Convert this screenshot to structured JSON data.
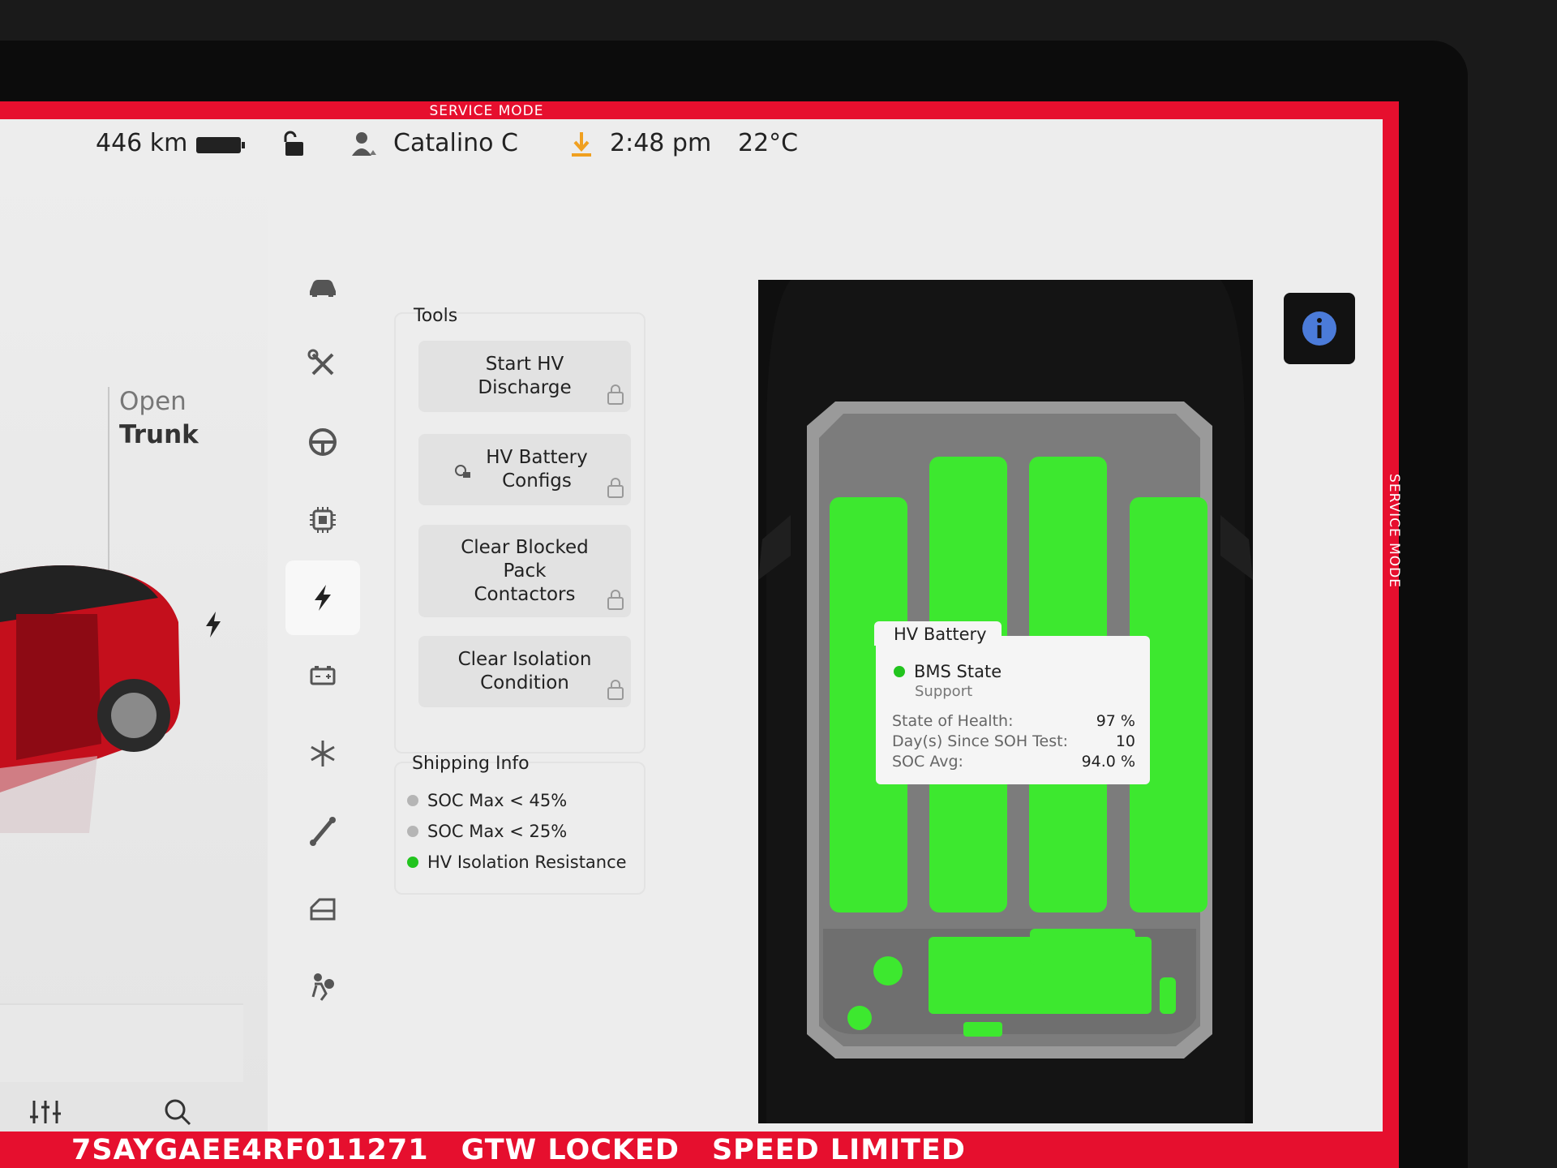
{
  "banner": {
    "top": "SERVICE MODE",
    "right": "SERVICE MODE"
  },
  "status": {
    "range": "446 km",
    "user": "Catalino C",
    "time": "2:48 pm",
    "temp": "22°C"
  },
  "car": {
    "trunk_open": "Open",
    "trunk_label": "Trunk"
  },
  "tools": {
    "title": "Tools",
    "items": [
      {
        "label": "Start HV Discharge"
      },
      {
        "label": "HV Battery Configs"
      },
      {
        "label": "Clear Blocked Pack Contactors"
      },
      {
        "label": "Clear Isolation Condition"
      }
    ]
  },
  "shipping": {
    "title": "Shipping Info",
    "items": [
      {
        "label": "SOC Max < 45%",
        "color": "#b5b5b5"
      },
      {
        "label": "SOC Max < 25%",
        "color": "#b5b5b5"
      },
      {
        "label": "HV Isolation Resistance",
        "color": "#22c41e"
      }
    ]
  },
  "battery_card": {
    "title": "HV Battery",
    "bms_label": "BMS State",
    "bms_value": "Support",
    "soh_label": "State of Health:",
    "soh_value": "97 %",
    "days_label": "Day(s) Since SOH Test:",
    "days_value": "10",
    "soc_label": "SOC Avg:",
    "soc_value": "94.0 %"
  },
  "footer": {
    "vin": "7SAYGAEE4RF011271",
    "gtw": "GTW LOCKED",
    "speed": "SPEED LIMITED"
  },
  "colors": {
    "frame": "#e60f2e",
    "module_green": "#3de82f",
    "status_green": "#22c41e"
  }
}
